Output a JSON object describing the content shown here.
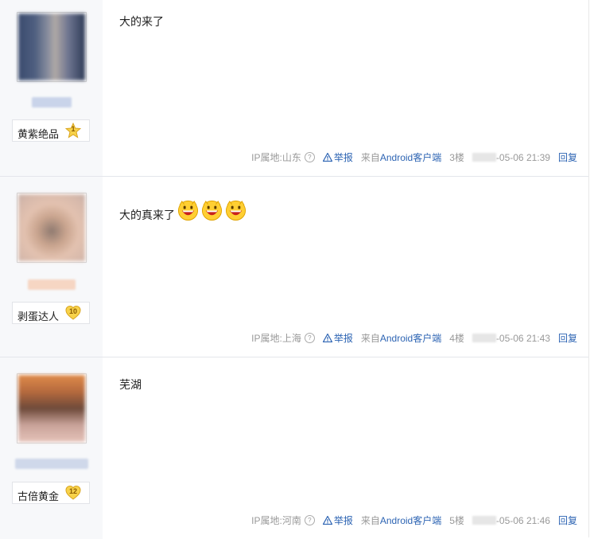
{
  "posts": [
    {
      "content": "大的来了",
      "badge_title": "黄紫绝品",
      "level": "1",
      "ip": "IP属地:山东",
      "report": "举报",
      "from_prefix": "来自",
      "client": "Android客户端",
      "floor": "3楼",
      "datetime": "-05-06 21:39",
      "reply": "回复"
    },
    {
      "content": "大的真来了",
      "emojis": [
        "grin-face-icon",
        "grin-face-icon",
        "grin-face-icon"
      ],
      "badge_title": "剥蛋达人",
      "level": "10",
      "ip": "IP属地:上海",
      "report": "举报",
      "from_prefix": "来自",
      "client": "Android客户端",
      "floor": "4楼",
      "datetime": "-05-06 21:43",
      "reply": "回复"
    },
    {
      "content": "芜湖",
      "badge_title": "古倍黄金",
      "level": "12",
      "ip": "IP属地:河南",
      "report": "举报",
      "from_prefix": "来自",
      "client": "Android客户端",
      "floor": "5楼",
      "datetime": "-05-06 21:46",
      "reply": "回复"
    }
  ],
  "colors": {
    "link": "#2d64b3",
    "meta": "#999999",
    "sidebar": "#f7f8fa"
  }
}
